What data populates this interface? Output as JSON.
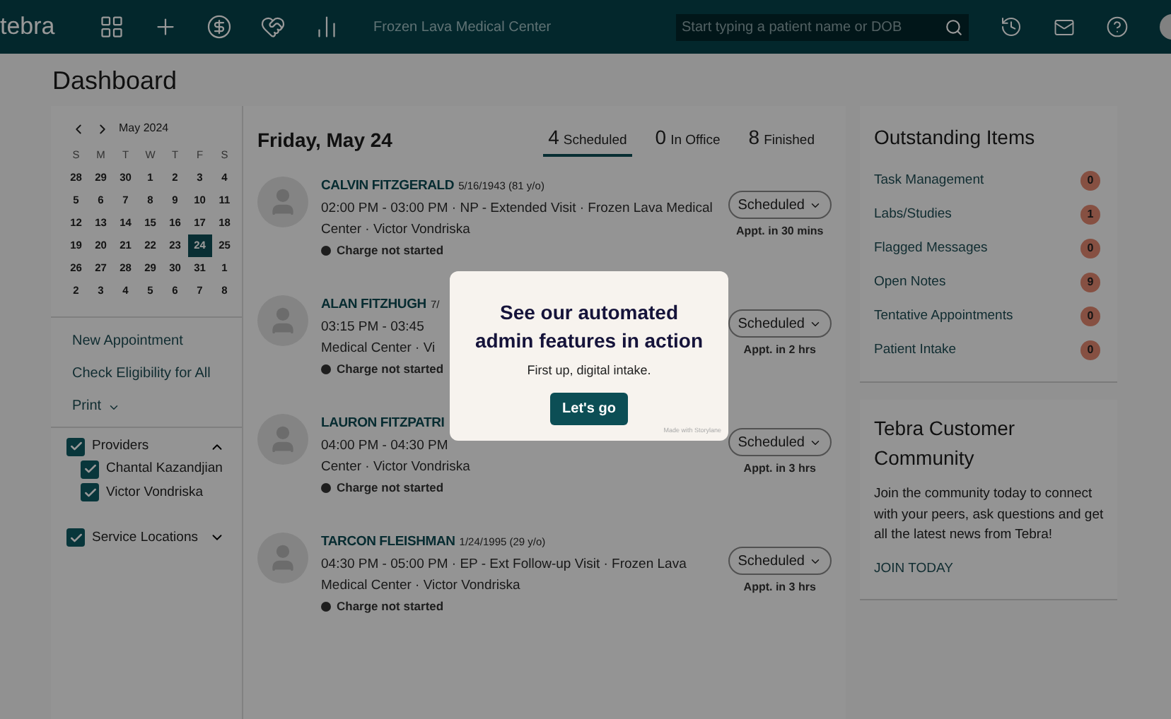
{
  "header": {
    "logo": "tebra",
    "clinic": "Frozen Lava Medical Center",
    "search": {
      "placeholder": "Start typing a patient name or DOB"
    }
  },
  "page_title": "Dashboard",
  "calendar": {
    "month": "May 2024",
    "weekdays": [
      "S",
      "M",
      "T",
      "W",
      "T",
      "F",
      "S"
    ],
    "days": [
      {
        "label": "28",
        "selected": false
      },
      {
        "label": "29",
        "selected": false
      },
      {
        "label": "30",
        "selected": false
      },
      {
        "label": "1",
        "selected": false
      },
      {
        "label": "2",
        "selected": false
      },
      {
        "label": "3",
        "selected": false
      },
      {
        "label": "4",
        "selected": false
      },
      {
        "label": "5",
        "selected": false
      },
      {
        "label": "6",
        "selected": false
      },
      {
        "label": "7",
        "selected": false
      },
      {
        "label": "8",
        "selected": false
      },
      {
        "label": "9",
        "selected": false
      },
      {
        "label": "10",
        "selected": false
      },
      {
        "label": "11",
        "selected": false
      },
      {
        "label": "12",
        "selected": false
      },
      {
        "label": "13",
        "selected": false
      },
      {
        "label": "14",
        "selected": false
      },
      {
        "label": "15",
        "selected": false
      },
      {
        "label": "16",
        "selected": false
      },
      {
        "label": "17",
        "selected": false
      },
      {
        "label": "18",
        "selected": false
      },
      {
        "label": "19",
        "selected": false
      },
      {
        "label": "20",
        "selected": false
      },
      {
        "label": "21",
        "selected": false
      },
      {
        "label": "22",
        "selected": false
      },
      {
        "label": "23",
        "selected": false
      },
      {
        "label": "24",
        "selected": true
      },
      {
        "label": "25",
        "selected": false
      },
      {
        "label": "26",
        "selected": false
      },
      {
        "label": "27",
        "selected": false
      },
      {
        "label": "28",
        "selected": false
      },
      {
        "label": "29",
        "selected": false
      },
      {
        "label": "30",
        "selected": false
      },
      {
        "label": "31",
        "selected": false
      },
      {
        "label": "1",
        "selected": false
      },
      {
        "label": "2",
        "selected": false
      },
      {
        "label": "3",
        "selected": false
      },
      {
        "label": "4",
        "selected": false
      },
      {
        "label": "5",
        "selected": false
      },
      {
        "label": "6",
        "selected": false
      },
      {
        "label": "7",
        "selected": false
      },
      {
        "label": "8",
        "selected": false
      }
    ]
  },
  "actions": [
    {
      "label": "New Appointment",
      "kind": "link"
    },
    {
      "label": "Check Eligibility for All",
      "kind": "link"
    },
    {
      "label": "Print",
      "kind": "menu"
    }
  ],
  "filters": [
    {
      "label": "Providers",
      "checked": true,
      "expanded": true,
      "children": [
        {
          "label": "Chantal Kazandjian",
          "checked": true
        },
        {
          "label": "Victor Vondriska",
          "checked": true
        }
      ]
    },
    {
      "label": "Service Locations",
      "checked": true,
      "expanded": false
    }
  ],
  "schedule": {
    "date": "Friday, May 24",
    "tabs": [
      {
        "count": "4",
        "label": "Scheduled",
        "selected": true
      },
      {
        "count": "0",
        "label": "In Office",
        "selected": false
      },
      {
        "count": "8",
        "label": "Finished",
        "selected": false
      }
    ],
    "appointments": [
      {
        "name": "CALVIN FITZGERALD",
        "dob": "5/16/1943 (81 y/o)",
        "line1": "02:00 PM - 03:00 PM · NP - Extended Visit · Frozen Lava Medical",
        "line2": "Center · Victor Vondriska",
        "charge": "Charge not started",
        "status": "Scheduled",
        "eta": "Appt. in 30 mins"
      },
      {
        "name": "ALAN FITZHUGH",
        "dob": "7/",
        "line1": "03:15 PM - 03:45",
        "line2": "Medical Center · Vi",
        "charge": "Charge not started",
        "status": "Scheduled",
        "eta": "Appt. in 2 hrs"
      },
      {
        "name": "LAURON FITZPATRI",
        "line1": "04:00 PM - 04:30 PM",
        "line2": "Center · Victor Vondriska",
        "charge": "Charge not started",
        "status": "Scheduled",
        "eta": "Appt. in 3 hrs"
      },
      {
        "name": "TARCON FLEISHMAN",
        "dob": "1/24/1995 (29 y/o)",
        "line1": "04:30 PM - 05:00 PM · EP - Ext Follow-up Visit · Frozen Lava",
        "line2": "Medical Center · Victor Vondriska",
        "charge": "Charge not started",
        "status": "Scheduled",
        "eta": "Appt. in 3 hrs"
      }
    ]
  },
  "outstanding": {
    "title": "Outstanding Items",
    "items": [
      {
        "label": "Task Management",
        "count": "0"
      },
      {
        "label": "Labs/Studies",
        "count": "1"
      },
      {
        "label": "Flagged Messages",
        "count": "0"
      },
      {
        "label": "Open Notes",
        "count": "9"
      },
      {
        "label": "Tentative Appointments",
        "count": "0"
      },
      {
        "label": "Patient Intake",
        "count": "0"
      }
    ]
  },
  "community": {
    "title": "Tebra Customer Community",
    "body": "Join the community today to connect with your peers, ask questions and get all the latest news from Tebra!",
    "link": "JOIN TODAY"
  },
  "modal": {
    "title": "See our automated admin features in action",
    "subtitle": "First up, digital intake.",
    "button": "Let's go",
    "credit": "Made with Storylane"
  }
}
